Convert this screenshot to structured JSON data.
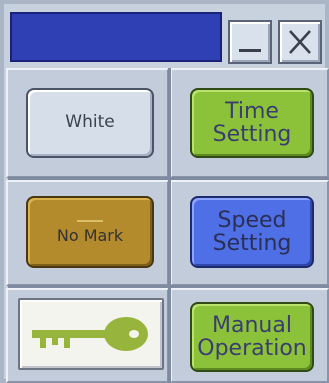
{
  "window": {
    "title": "",
    "minimize_label": "_",
    "close_label": "X"
  },
  "buttons": {
    "white": {
      "label": "White"
    },
    "time_setting": {
      "line1": "Time",
      "line2": "Setting"
    },
    "no_mark": {
      "label": "No Mark"
    },
    "speed_setting": {
      "line1": "Speed",
      "line2": "Setting"
    },
    "manual_operation": {
      "line1": "Manual",
      "line2": "Operation"
    },
    "lock": {
      "icon": "key-icon"
    }
  },
  "colors": {
    "title_bar": "#2f3fb4",
    "green_button": "#8cc23a",
    "gold_button": "#b38a2c",
    "blue_button": "#4f6fe6",
    "key": "#97b43c"
  }
}
